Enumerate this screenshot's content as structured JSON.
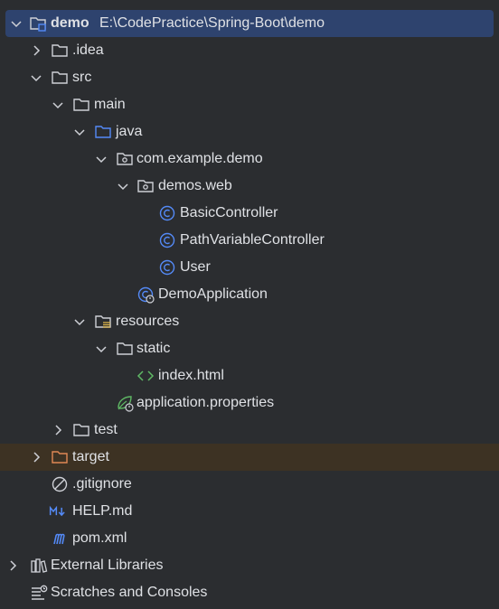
{
  "tree": {
    "root": {
      "name": "demo",
      "path": "E:\\CodePractice\\Spring-Boot\\demo"
    },
    "idea": ".idea",
    "src": "src",
    "main": "main",
    "java": "java",
    "pkg": "com.example.demo",
    "demos_web": "demos.web",
    "basic_controller": "BasicController",
    "path_variable_controller": "PathVariableController",
    "user": "User",
    "demo_application": "DemoApplication",
    "resources": "resources",
    "static": "static",
    "index_html": "index.html",
    "application_properties": "application.properties",
    "test": "test",
    "target": "target",
    "gitignore": ".gitignore",
    "help_md": "HELP.md",
    "pom_xml": "pom.xml",
    "external_libraries": "External Libraries",
    "scratches": "Scratches and Consoles"
  },
  "colors": {
    "selection": "#2e436e",
    "excluded_row": "#3d3223",
    "folder": "#ced0d6",
    "source_folder": "#548af7",
    "class_icon": "#548af7",
    "excluded_folder": "#e08855",
    "html_icon": "#5fb865",
    "markdown_icon": "#548af7"
  }
}
